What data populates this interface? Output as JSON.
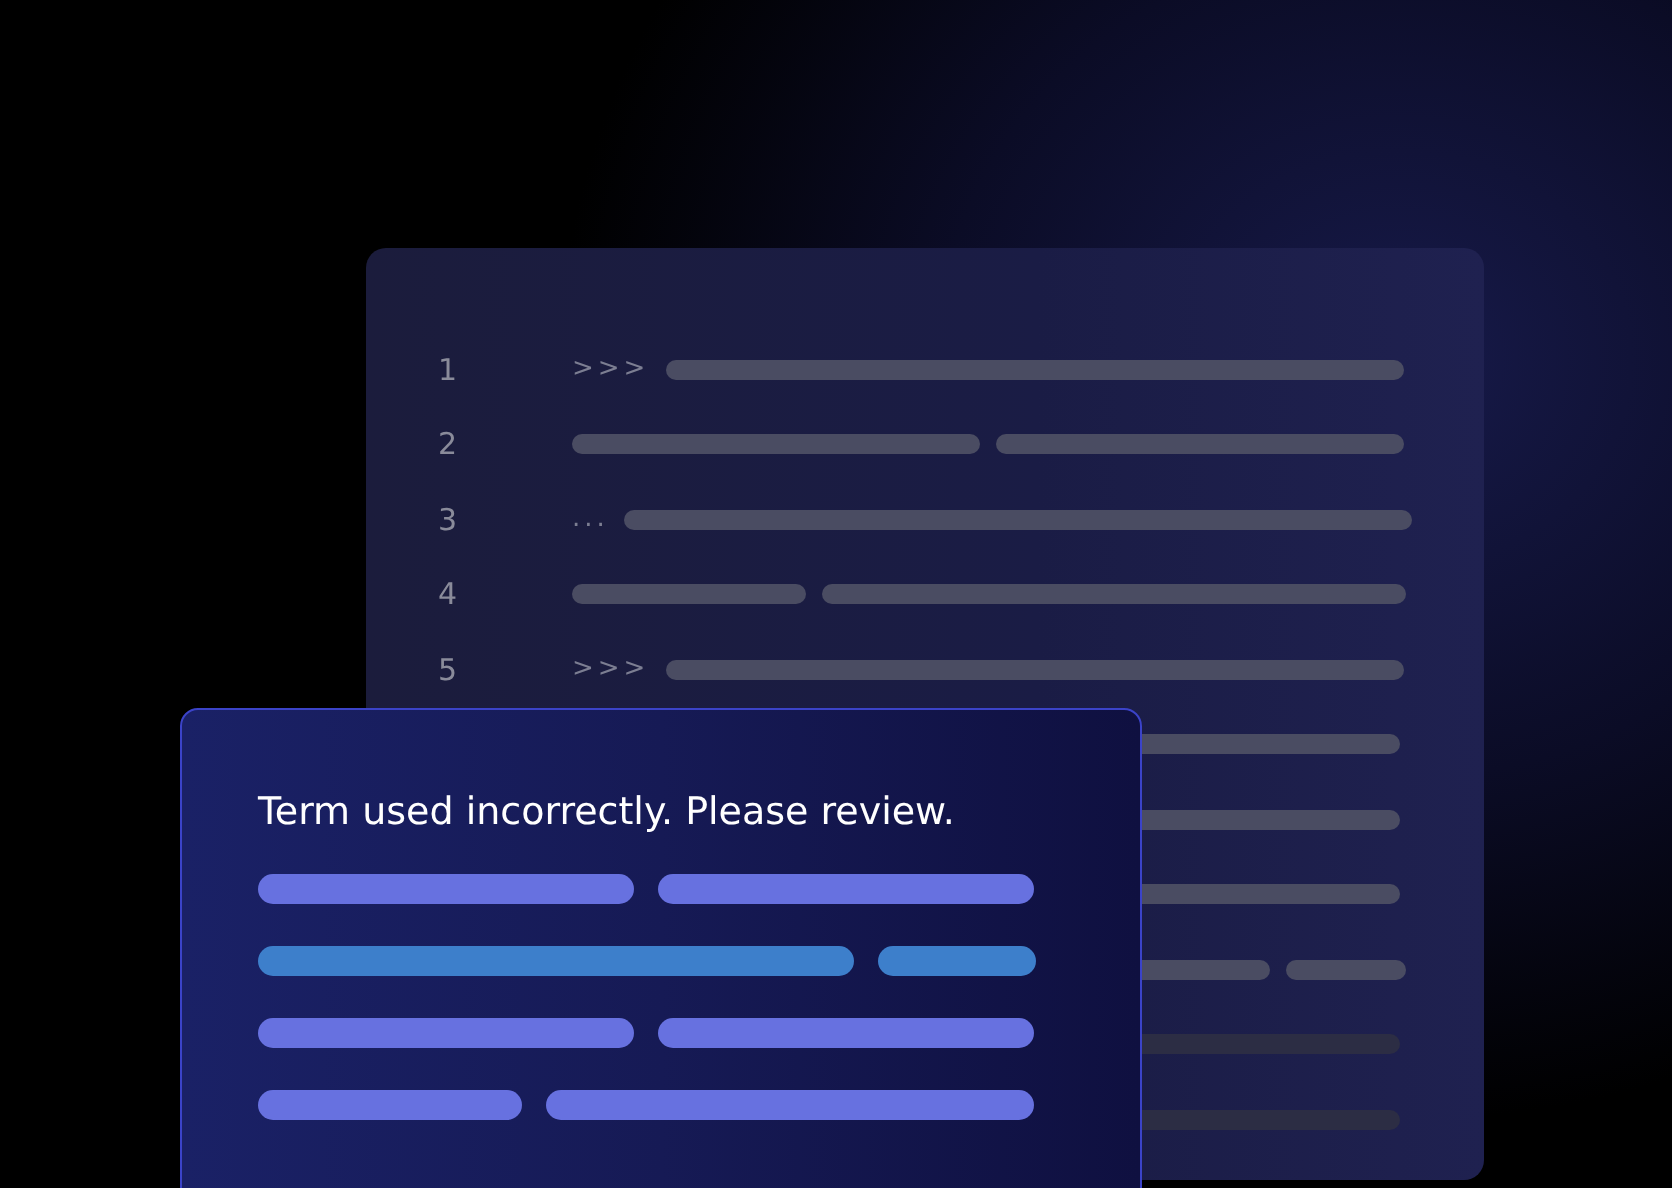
{
  "editor": {
    "lines": [
      {
        "number": "1",
        "prompt": ">>>"
      },
      {
        "number": "2"
      },
      {
        "number": "3",
        "prompt": "..."
      },
      {
        "number": "4"
      },
      {
        "number": "5",
        "prompt": ">>>"
      }
    ]
  },
  "popup": {
    "message": "Term used incorrectly. Please review.",
    "rows": [
      {
        "highlighted": false
      },
      {
        "highlighted": true
      },
      {
        "highlighted": false
      },
      {
        "highlighted": false
      }
    ]
  }
}
